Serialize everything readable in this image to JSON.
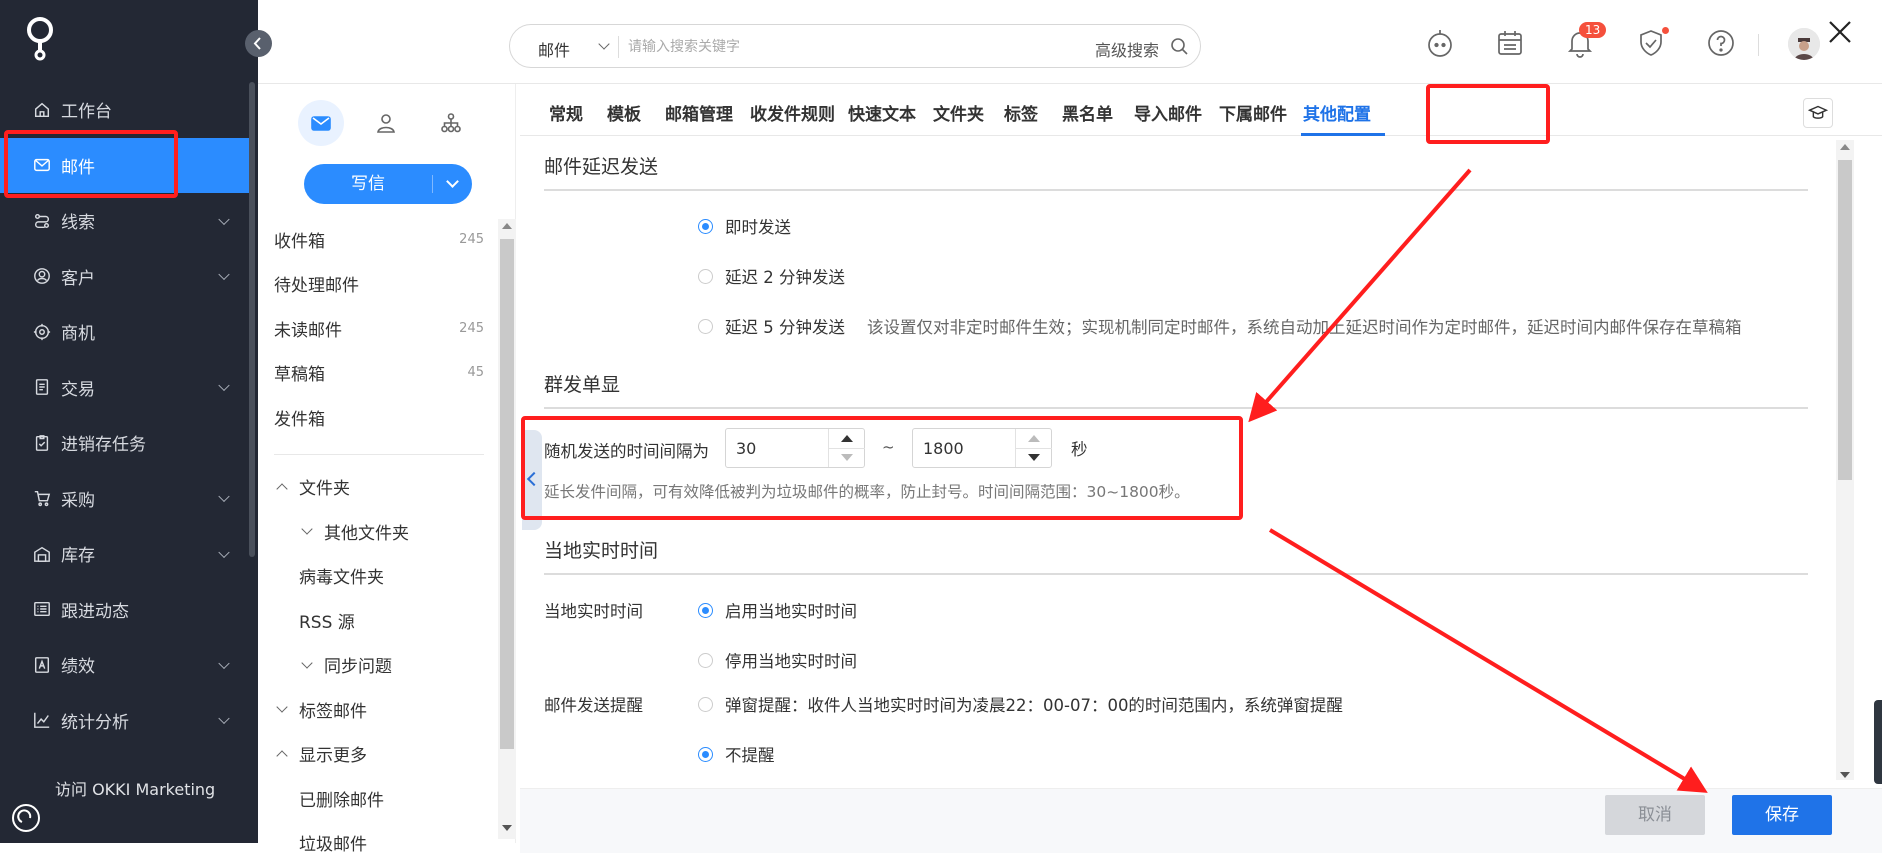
{
  "nav": {
    "items": [
      {
        "label": "工作台",
        "icon": "home-icon",
        "expandable": false
      },
      {
        "label": "邮件",
        "icon": "mail-icon",
        "expandable": false,
        "active": true
      },
      {
        "label": "线索",
        "icon": "route-icon",
        "expandable": true
      },
      {
        "label": "客户",
        "icon": "customer-icon",
        "expandable": true
      },
      {
        "label": "商机",
        "icon": "target-icon",
        "expandable": false
      },
      {
        "label": "交易",
        "icon": "document-icon",
        "expandable": true
      },
      {
        "label": "进销存任务",
        "icon": "clipboard-icon",
        "expandable": false
      },
      {
        "label": "采购",
        "icon": "cart-icon",
        "expandable": true
      },
      {
        "label": "库存",
        "icon": "warehouse-icon",
        "expandable": true
      },
      {
        "label": "跟进动态",
        "icon": "list-icon",
        "expandable": false
      },
      {
        "label": "绩效",
        "icon": "badge-icon",
        "expandable": true
      },
      {
        "label": "统计分析",
        "icon": "chart-icon",
        "expandable": true
      }
    ],
    "okki_link": "访问 OKKI Marketing"
  },
  "search": {
    "mode": "邮件",
    "placeholder": "请输入搜索关键字",
    "advanced": "高级搜索"
  },
  "topbar": {
    "notification_count": "13",
    "icons": [
      "assistant-icon",
      "calendar-icon",
      "bell-icon",
      "shield-check-icon",
      "help-icon",
      "avatar",
      "close-icon"
    ]
  },
  "sidebar": {
    "compose": "写信",
    "folders": [
      {
        "label": "收件箱",
        "count": "245",
        "level": 0
      },
      {
        "label": "待处理邮件",
        "count": "",
        "level": 0
      },
      {
        "label": "未读邮件",
        "count": "245",
        "level": 0
      },
      {
        "label": "草稿箱",
        "count": "45",
        "level": 0
      },
      {
        "label": "发件箱",
        "count": "",
        "level": 0
      }
    ],
    "groups": [
      {
        "label": "文件夹",
        "arrow": "up",
        "level": 0
      },
      {
        "label": "其他文件夹",
        "arrow": "down",
        "level": 1
      },
      {
        "label": "病毒文件夹",
        "arrow": "",
        "level": 1
      },
      {
        "label": "RSS 源",
        "arrow": "",
        "level": 1
      },
      {
        "label": "同步问题",
        "arrow": "down",
        "level": 1
      },
      {
        "label": "标签邮件",
        "arrow": "down",
        "level": 0
      },
      {
        "label": "显示更多",
        "arrow": "up",
        "level": 0
      },
      {
        "label": "已删除邮件",
        "arrow": "",
        "level": 1
      },
      {
        "label": "垃圾邮件",
        "arrow": "",
        "level": 1
      }
    ]
  },
  "tabs": [
    "常规",
    "模板",
    "邮箱管理",
    "收发件规则",
    "快速文本",
    "文件夹",
    "标签",
    "黑名单",
    "导入邮件",
    "下属邮件",
    "其他配置"
  ],
  "active_tab": "其他配置",
  "delay": {
    "title": "邮件延迟发送",
    "options": [
      "即时发送",
      "延迟 2 分钟发送",
      "延迟 5 分钟发送"
    ],
    "selected": "即时发送",
    "note": "该设置仅对非定时邮件生效；实现机制同定时邮件，系统自动加上延迟时间作为定时邮件，延迟时间内邮件保存在草稿箱"
  },
  "mass": {
    "title": "群发单显",
    "interval_label": "随机发送的时间间隔为",
    "min": "30",
    "max": "1800",
    "tilde": "~",
    "unit": "秒",
    "hint": "延长发件间隔，可有效降低被判为垃圾邮件的概率，防止封号。时间间隔范围：30~1800秒。"
  },
  "local_time": {
    "title": "当地实时时间",
    "label": "当地实时时间",
    "options": [
      "启用当地实时时间",
      "停用当地实时时间"
    ],
    "selected": "启用当地实时时间",
    "reminder_label": "邮件发送提醒",
    "reminder_options": [
      "弹窗提醒：收件人当地实时时间为凌晨22：00-07：00的时间范围内，系统弹窗提醒",
      "不提醒"
    ],
    "reminder_selected": "不提醒"
  },
  "footer": {
    "cancel": "取消",
    "save": "保存"
  },
  "colors": {
    "accent": "#2b8cff",
    "nav_bg": "#232834",
    "annotation": "#ff1e1e"
  }
}
